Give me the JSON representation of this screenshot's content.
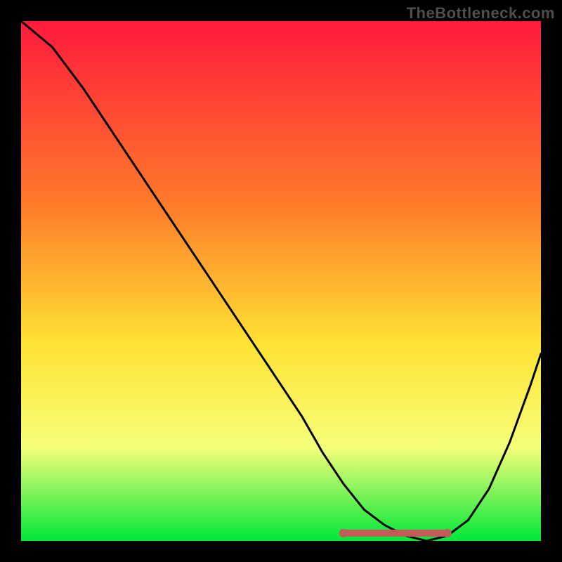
{
  "watermark": "TheBottleneck.com",
  "colors": {
    "background": "#000000",
    "gradient_top": "#ff1a3c",
    "gradient_mid1": "#ff7a2a",
    "gradient_mid2": "#ffe233",
    "gradient_mid3": "#f6ff7a",
    "gradient_bottom": "#00e838",
    "curve": "#000000",
    "optimal_marker": "#c55a5a",
    "watermark": "#4f4f4f"
  },
  "chart_data": {
    "type": "line",
    "title": "",
    "xlabel": "",
    "ylabel": "",
    "xlim": [
      0,
      100
    ],
    "ylim": [
      0,
      100
    ],
    "x": [
      0,
      6,
      12,
      18,
      24,
      30,
      36,
      42,
      48,
      54,
      58,
      62,
      66,
      70,
      74,
      78,
      82,
      86,
      90,
      94,
      98,
      100
    ],
    "values": [
      100,
      95,
      87,
      78,
      69,
      60,
      51,
      42,
      33,
      24,
      17,
      11,
      6,
      3,
      1,
      0,
      1,
      4,
      10,
      19,
      30,
      36
    ],
    "optimal_range_x": [
      62,
      82
    ],
    "optimal_y": 1.5,
    "annotations": []
  }
}
